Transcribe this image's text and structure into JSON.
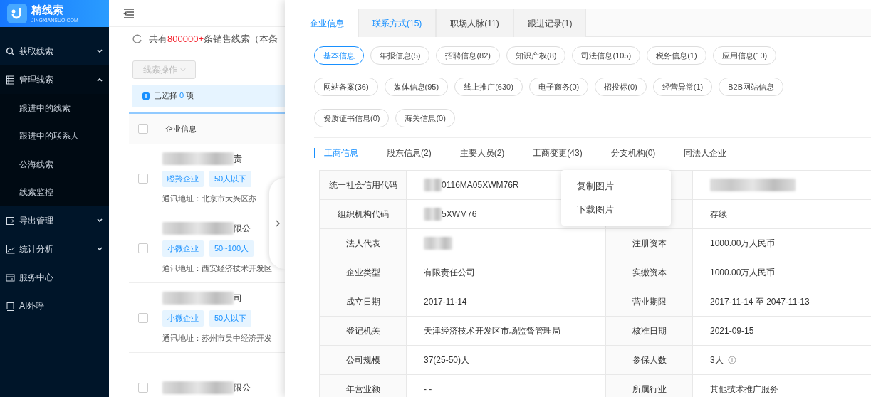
{
  "sidebar": {
    "logo": {
      "name": "精线索",
      "sub": "JINGXIANSUO.COM"
    },
    "items": [
      {
        "label": "获取线索",
        "expanded": false
      },
      {
        "label": "管理线索",
        "expanded": true,
        "children": [
          {
            "label": "跟进中的线索"
          },
          {
            "label": "跟进中的联系人"
          },
          {
            "label": "公海线索"
          },
          {
            "label": "线索监控"
          }
        ]
      },
      {
        "label": "导出管理",
        "expanded": false
      },
      {
        "label": "统计分析",
        "expanded": false
      },
      {
        "label": "服务中心"
      },
      {
        "label": "AI外呼"
      }
    ]
  },
  "list": {
    "summary": {
      "prefix": "共有",
      "count": "800000+",
      "suffix": "条销售线索（本条"
    },
    "action_button": {
      "label": "线索操作",
      "disabled": true
    },
    "selection": {
      "prefix": "已选择",
      "count": "0",
      "suffix": "项"
    },
    "header": "企业信息",
    "header_checked": false,
    "rows": [
      {
        "checked": false,
        "name_tail": "责",
        "tags": [
          "瞪羚企业",
          "50人以下"
        ],
        "address": "通讯地址：北京市大兴区亦"
      },
      {
        "checked": false,
        "name_tail": "限公",
        "tags": [
          "小微企业",
          "50~100人"
        ],
        "address": "通讯地址：西安经济技术开发区"
      },
      {
        "checked": false,
        "name_tail": "司",
        "tags": [
          "小微企业",
          "50人以下"
        ],
        "address": "通讯地址：苏州市吴中经济开发"
      },
      {
        "checked": false,
        "name_tail": "限公",
        "tags": [],
        "address": ""
      }
    ]
  },
  "drawer": {
    "tabs": [
      {
        "label": "企业信息",
        "selected": true,
        "hover": false
      },
      {
        "label": "联系方式(15)",
        "selected": false,
        "hover": true
      },
      {
        "label": "职场人脉(11)",
        "selected": false,
        "hover": false
      },
      {
        "label": "跟进记录(1)",
        "selected": false,
        "hover": false
      }
    ],
    "pills": [
      {
        "label": "基本信息",
        "selected": true
      },
      {
        "label": "年报信息(5)",
        "selected": false
      },
      {
        "label": "招聘信息(82)",
        "selected": false
      },
      {
        "label": "知识产权(8)",
        "selected": false
      },
      {
        "label": "司法信息(105)",
        "selected": false
      },
      {
        "label": "税务信息(1)",
        "selected": false
      },
      {
        "label": "应用信息(10)",
        "selected": false
      },
      {
        "label": "网站备案(36)",
        "selected": false
      },
      {
        "label": "媒体信息(95)",
        "selected": false
      },
      {
        "label": "线上推广(630)",
        "selected": false
      },
      {
        "label": "电子商务(0)",
        "selected": false
      },
      {
        "label": "招投标(0)",
        "selected": false
      },
      {
        "label": "经营异常(1)",
        "selected": false
      },
      {
        "label": "B2B网站信息",
        "selected": false
      },
      {
        "label": "资质证书信息(0)",
        "selected": false
      },
      {
        "label": "海关信息(0)",
        "selected": false
      }
    ],
    "subtabs": [
      {
        "label": "工商信息",
        "selected": true
      },
      {
        "label": "股东信息(2)",
        "selected": false
      },
      {
        "label": "主要人员(2)",
        "selected": false
      },
      {
        "label": "工商变更(43)",
        "selected": false
      },
      {
        "label": "分支机构(0)",
        "selected": false
      },
      {
        "label": "同法人企业",
        "selected": false
      }
    ],
    "info_rows": [
      {
        "label": "统一社会信用代码",
        "value": "0116MA05XWM76R",
        "redacted": true,
        "label_2": "",
        "value_2": "",
        "redacted_2": true
      },
      {
        "label": "组织机构代码",
        "value": "5XWM76",
        "redacted": true,
        "label_2": "",
        "value_2": "存续",
        "redacted_2": false
      },
      {
        "label": "法人代表",
        "value": "",
        "redacted": true,
        "label_2": "注册资本",
        "value_2": "1000.00万人民币",
        "redacted_2": false
      },
      {
        "label": "企业类型",
        "value": "有限责任公司",
        "redacted": false,
        "label_2": "实缴资本",
        "value_2": "1000.00万人民币",
        "redacted_2": false
      },
      {
        "label": "成立日期",
        "value": "2017-11-14",
        "redacted": false,
        "label_2": "营业期限",
        "value_2": "2017-11-14 至 2047-11-13",
        "redacted_2": false
      },
      {
        "label": "登记机关",
        "value": "天津经济技术开发区市场监督管理局",
        "redacted": false,
        "label_2": "核准日期",
        "value_2": "2021-09-15",
        "redacted_2": false
      },
      {
        "label": "公司规模",
        "value": "37(25-50)人",
        "redacted": false,
        "label_2": "参保人数",
        "value_2": "3人",
        "redacted_2": false,
        "info_2": true
      },
      {
        "label": "年营业额",
        "value": "- -",
        "redacted": false,
        "label_2": "所属行业",
        "value_2": "其他技术推广服务",
        "redacted_2": false
      }
    ]
  },
  "context_menu": {
    "items": [
      "复制图片",
      "下载图片"
    ]
  }
}
